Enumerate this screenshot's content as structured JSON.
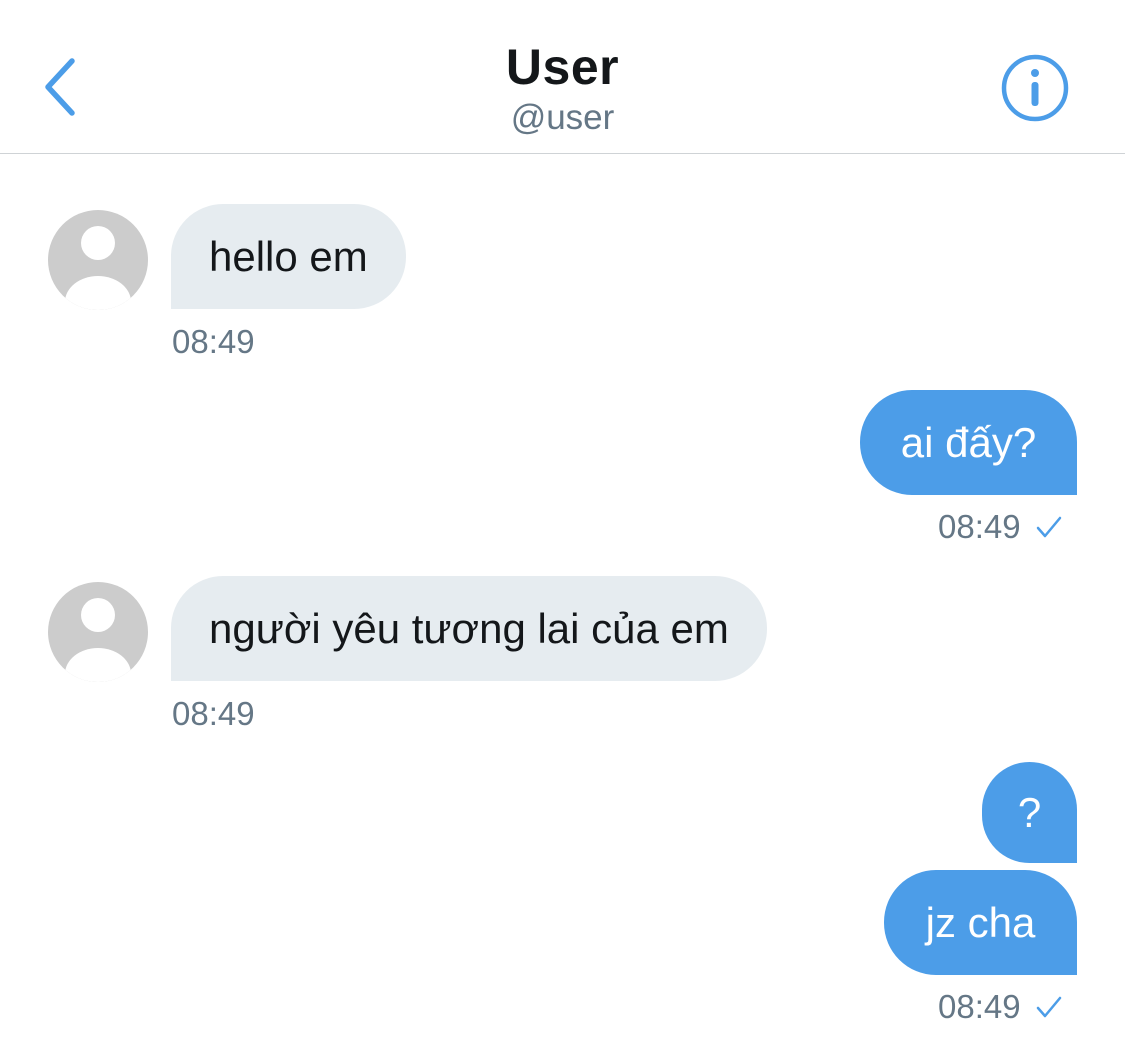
{
  "header": {
    "title": "User",
    "handle": "@user",
    "back_icon": "chevron-left-icon",
    "info_icon": "info-circle-icon"
  },
  "colors": {
    "accent": "#4c9de8",
    "incoming_bubble": "#e6ecf0",
    "text_primary": "#14171a",
    "text_secondary": "#657786"
  },
  "messages": [
    {
      "direction": "incoming",
      "text": "hello em",
      "time": "08:49"
    },
    {
      "direction": "outgoing",
      "text": "ai đấy?",
      "time": "08:49",
      "status_icon": "check-icon"
    },
    {
      "direction": "incoming",
      "text": "người yêu tương lai của em",
      "time": "08:49"
    },
    {
      "direction": "outgoing",
      "text": "?"
    },
    {
      "direction": "outgoing",
      "text": "jz cha",
      "time": "08:49",
      "status_icon": "check-icon"
    }
  ]
}
